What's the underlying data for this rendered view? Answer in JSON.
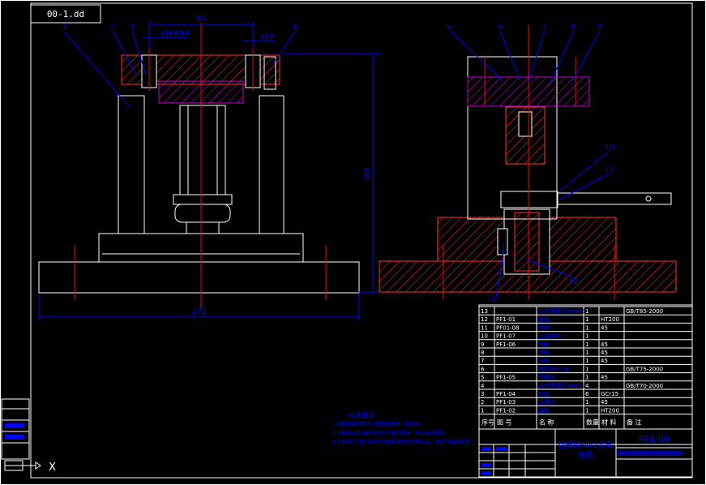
{
  "title_tab": "00-1.dd",
  "dims": {
    "top_width": "65",
    "bore": "ø16F/k6",
    "small_dia": "ø20",
    "height": "300",
    "base_width": "270"
  },
  "left_balloons": [
    "1",
    "2",
    "3",
    "4"
  ],
  "right_balloons": [
    "5",
    "6",
    "7",
    "8",
    "9"
  ],
  "side_balloons": [
    "10",
    "11",
    "12",
    "13"
  ],
  "bom_rows": [
    {
      "no": "13",
      "code": "",
      "name": "内六角螺钉M6x16",
      "qty": "1",
      "material": "",
      "note": "GB/T85-2000"
    },
    {
      "no": "12",
      "code": "PF1-01",
      "name": "底座",
      "qty": "1",
      "material": "HT200",
      "note": ""
    },
    {
      "no": "11",
      "code": "PF01-08",
      "name": "手柄",
      "qty": "1",
      "material": "45",
      "note": ""
    },
    {
      "no": "10",
      "code": "PF1-07",
      "name": "压紧螺母",
      "qty": "1",
      "material": "",
      "note": ""
    },
    {
      "no": "9",
      "code": "PF1-06",
      "name": "销轴",
      "qty": "1",
      "material": "45",
      "note": ""
    },
    {
      "no": "8",
      "code": "",
      "name": "垫板",
      "qty": "1",
      "material": "45",
      "note": ""
    },
    {
      "no": "7",
      "code": "",
      "name": "压板",
      "qty": "1",
      "material": "45",
      "note": ""
    },
    {
      "no": "6",
      "code": "",
      "name": "螺钉M6x16",
      "qty": "1",
      "material": "",
      "note": "GB/T75-2000"
    },
    {
      "no": "5",
      "code": "PF1-05",
      "name": "钻模板",
      "qty": "1",
      "material": "45",
      "note": ""
    },
    {
      "no": "4",
      "code": "",
      "name": "内六角螺钉M6x22",
      "qty": "4",
      "material": "",
      "note": "GB/T70-2000"
    },
    {
      "no": "3",
      "code": "PF1-04",
      "name": "钻套",
      "qty": "6",
      "material": "GCr15",
      "note": ""
    },
    {
      "no": "2",
      "code": "PF1-03",
      "name": "支承柱",
      "qty": "1",
      "material": "45",
      "note": ""
    },
    {
      "no": "1",
      "code": "PF1-02",
      "name": "底板",
      "qty": "1",
      "material": "HT200",
      "note": ""
    }
  ],
  "bom_header": {
    "no": "序号",
    "code": "图 号",
    "name": "名 称",
    "qty": "数量",
    "material": "材 料",
    "note": "备 注"
  },
  "title_block": {
    "drawing_title": "钻模板Fx42夹具",
    "subtitle": "总图",
    "drawing_no": "PF1-00"
  },
  "tech_notes": {
    "heading": "技术要求",
    "items": [
      "1  装配前所有零件均需清洗干净，去毛刺。",
      "2  钻模板与底座配合处涂少量润滑油，保证活动灵活。",
      "3  钻套中心与定位销中心距离误差不大于0.02，保证同轴度要求。"
    ]
  },
  "ucs_label": "X",
  "colors": {
    "bg": "#000000",
    "outline": "#ffffff",
    "dimension": "#0000ff",
    "centerline": "#ff0000",
    "hatch": "#ff3030",
    "part": "#c000c0"
  }
}
